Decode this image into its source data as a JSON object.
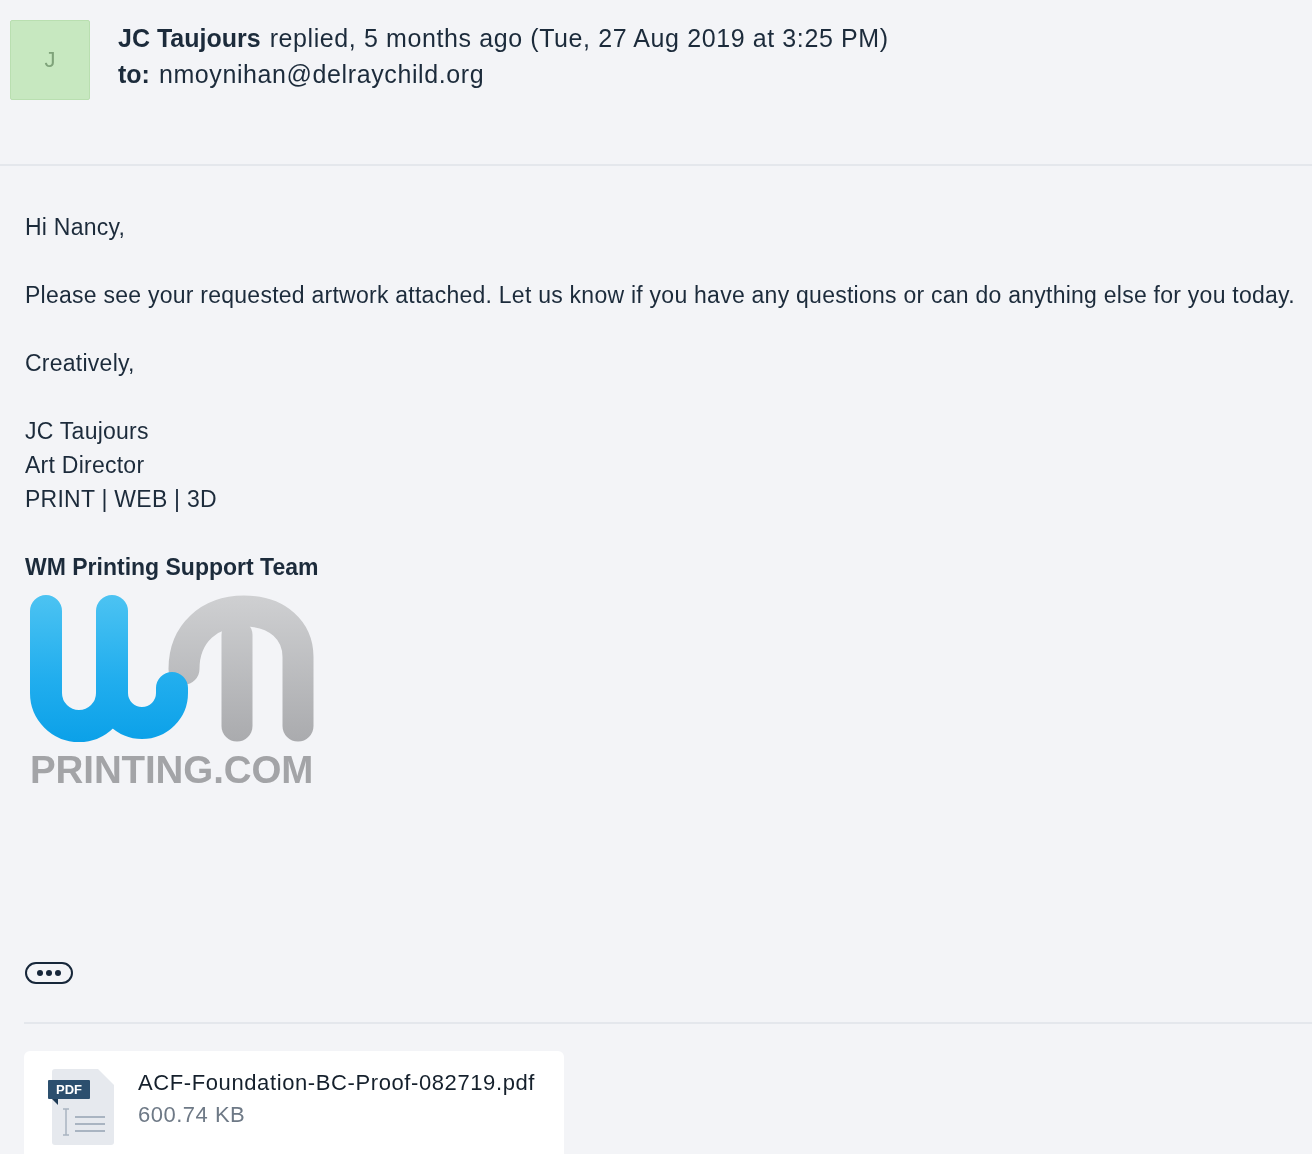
{
  "message": {
    "avatar": {
      "initial": "J"
    },
    "sender": "JC Taujours",
    "action": "replied, 5 months ago (Tue, 27 Aug 2019 at 3:25 PM)",
    "to_label": "to:",
    "to_address": "nmoynihan@delraychild.org"
  },
  "body": {
    "paragraphs": [
      [
        "Hi Nancy,"
      ],
      [
        "Please see your requested artwork attached. Let us know if you have any questions or can do anything else for you today."
      ],
      [
        "Creatively,"
      ],
      [
        "JC Taujours",
        "Art Director",
        "PRINT | WEB | 3D"
      ]
    ],
    "signature_heading": "WM Printing Support Team",
    "logo": {
      "text": "PRINTING.COM"
    }
  },
  "attachments": [
    {
      "kind": "pdf",
      "badge": "PDF",
      "name": "ACF-Foundation-BC-Proof-082719.pdf",
      "size": "600.74 KB"
    }
  ]
}
